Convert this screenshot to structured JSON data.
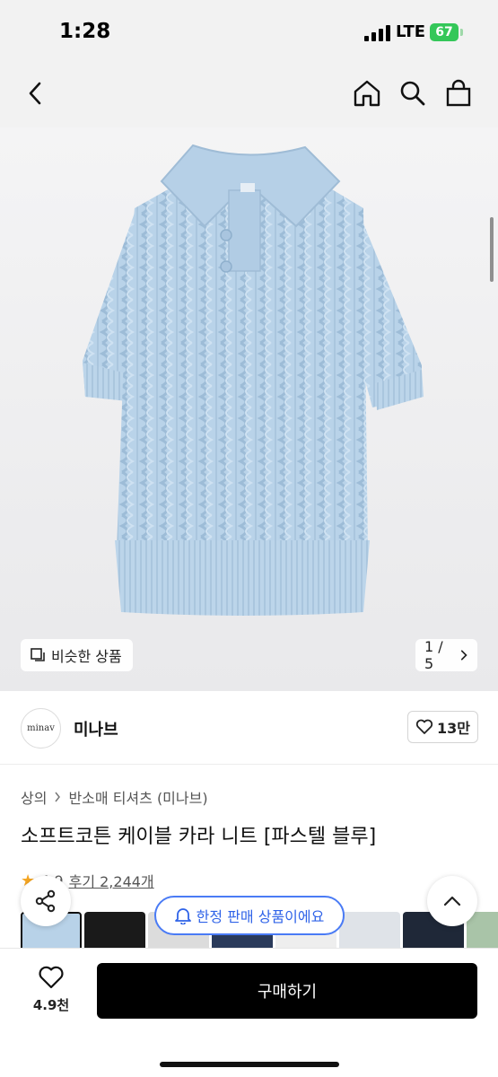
{
  "status_bar": {
    "time": "1:28",
    "network": "LTE",
    "battery": "67"
  },
  "nav": {
    "back_icon": "chevron-left-icon",
    "home_icon": "home-icon",
    "search_icon": "search-icon",
    "cart_icon": "shopping-bag-icon"
  },
  "gallery": {
    "similar_label": "비슷한 상품",
    "counter": "1 / 5",
    "product_color": "#b8d2e8"
  },
  "seller": {
    "logo_text": "minav",
    "name": "미나브",
    "like_count": "13만"
  },
  "breadcrumb": {
    "level1": "상의",
    "level2": "반소매 티셔츠 (미나브)"
  },
  "product": {
    "title": "소프트코튼 케이블 카라 니트 [파스텔 블루]",
    "rating": "4.9",
    "reviews": "후기 2,244개"
  },
  "limited_notice": "한정 판매 상품이에요",
  "thumbnails": [
    "#b8d2e8",
    "#1a1a1a",
    "#dcdcdc",
    "#2a3a5a",
    "#eeeeee",
    "#dfe3e8",
    "#1f2838",
    "#a9c4a8",
    "#cdbfa8"
  ],
  "bottom": {
    "wish_count": "4.9천",
    "buy_label": "구매하기"
  },
  "colors": {
    "accent_blue": "#2f63e8",
    "buy_bg": "#000000",
    "star": "#f5a623"
  }
}
